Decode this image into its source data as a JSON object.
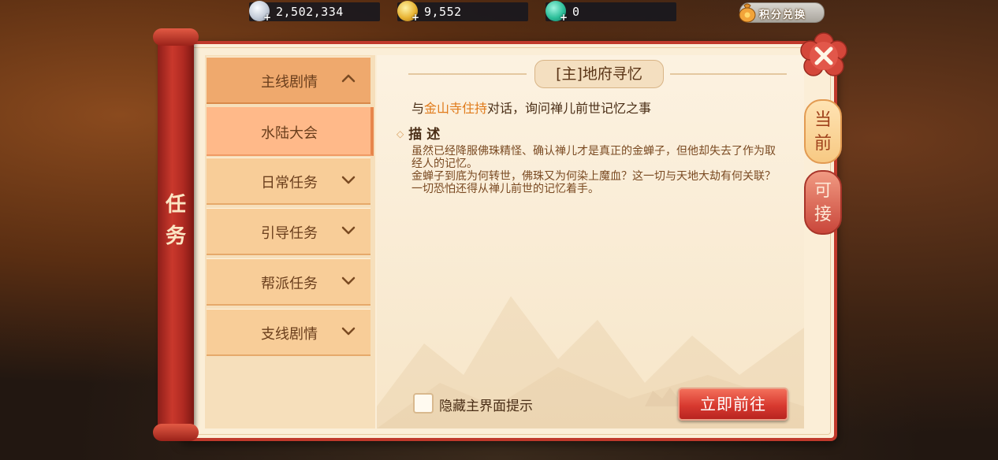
{
  "currency": {
    "silver": "2,502,334",
    "gold": "9,552",
    "jade": "0"
  },
  "exchange_label": "积分兑换",
  "sidebar_title": [
    "任",
    "务"
  ],
  "categories": [
    {
      "label": "主线剧情",
      "expanded": true
    },
    {
      "label": "日常任务",
      "expanded": false
    },
    {
      "label": "引导任务",
      "expanded": false
    },
    {
      "label": "帮派任务",
      "expanded": false
    },
    {
      "label": "支线剧情",
      "expanded": false
    }
  ],
  "selected_sub": "水陆大会",
  "quest": {
    "title": "[主]地府寻忆",
    "goal_prefix": "与",
    "goal_npc": "金山寺住持",
    "goal_suffix": "对话，询问禅儿前世记忆之事",
    "desc_heading": "描述",
    "desc_lines": [
      "虽然已经降服佛珠精怪、确认禅儿才是真正的金蝉子，但他却失去了作为取经人的记忆。",
      "金蝉子到底为何转世，佛珠又为何染上魔血？这一切与天地大劫有何关联？一切恐怕还得从禅儿前世的记忆着手。"
    ]
  },
  "hide_hint_label": "隐藏主界面提示",
  "hide_hint_checked": false,
  "go_button": "立即前往",
  "tabs": [
    {
      "label": "当前",
      "active": true
    },
    {
      "label": "可接",
      "active": false
    }
  ],
  "colors": {
    "frame_red": "#c0392b",
    "highlight_orange": "#e07a1a",
    "panel_bg": "#fbeed7"
  }
}
